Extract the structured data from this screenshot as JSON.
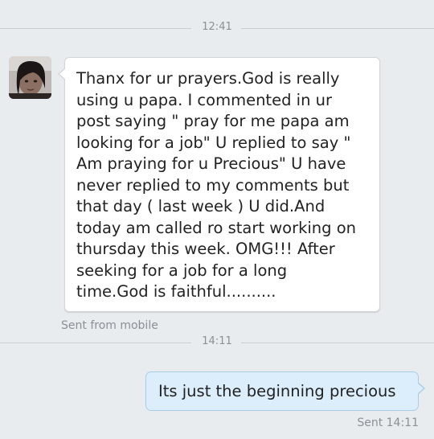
{
  "conversation": {
    "dividers": [
      {
        "time": "12:41"
      },
      {
        "time": "14:11"
      }
    ],
    "incoming": {
      "avatar_icon": "contact-avatar",
      "text": "Thanx for ur prayers.God is really\nusing u papa. I commented in ur\npost saying \" pray for me papa am\nlooking for a job\" U replied to say \"\nAm praying for u Precious\" U have\nnever replied to my comments but\nthat day ( last week ) U did.And\ntoday am called ro start working on\nthursday this week. OMG!!! After\nseeking for a job for a long\ntime.God is faithful..........",
      "meta": "Sent from mobile"
    },
    "outgoing": {
      "text": "Its just the beginning precious",
      "meta": "Sent 14:11"
    }
  },
  "colors": {
    "background": "#e8ecef",
    "incoming_bubble": "#ffffff",
    "outgoing_bubble": "#dceefb",
    "outgoing_border": "#a9cde6",
    "meta_text": "#8a9096"
  }
}
